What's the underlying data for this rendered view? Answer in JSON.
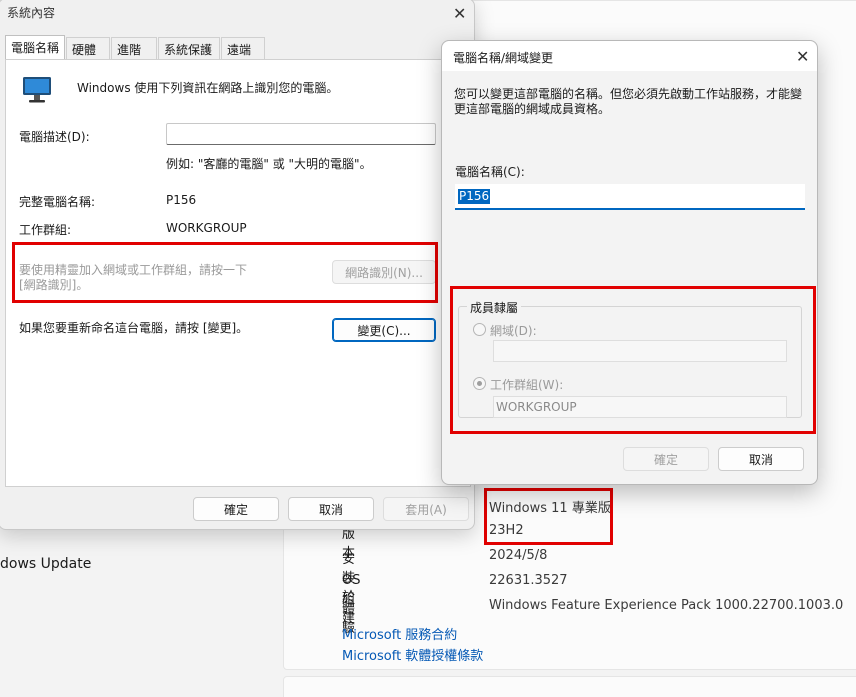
{
  "background": {
    "sidebar_item": "dows Update",
    "windows_edition": "Windows 11 專業版",
    "specs": [
      {
        "label": "版本",
        "value": "23H2"
      },
      {
        "label": "安裝於",
        "value": "2024/5/8"
      },
      {
        "label": "OS 組建",
        "value": "22631.3527"
      },
      {
        "label": "體驗",
        "value": "Windows Feature Experience Pack 1000.22700.1003.0"
      }
    ],
    "links": [
      "Microsoft 服務合約",
      "Microsoft 軟體授權條款"
    ]
  },
  "system_properties": {
    "title": "系統內容",
    "close_icon": "close-icon",
    "tabs": [
      "電腦名稱",
      "硬體",
      "進階",
      "系統保護",
      "遠端"
    ],
    "active_tab": "電腦名稱",
    "intro": "Windows 使用下列資訊在網路上識別您的電腦。",
    "description_label": "電腦描述(D):",
    "description_value": "",
    "example": "例如: \"客廳的電腦\" 或 \"大明的電腦\"。",
    "full_name_label": "完整電腦名稱:",
    "full_name_value": "P156",
    "workgroup_label": "工作群組:",
    "workgroup_value": "WORKGROUP",
    "network_text_line1": "要使用精靈加入網域或工作群組，請按一下",
    "network_text_line2": "[網路識別]。",
    "network_id_button": "網路識別(N)...",
    "rename_text": "如果您要重新命名這台電腦，請按 [變更]。",
    "change_button": "變更(C)...",
    "ok_button": "確定",
    "cancel_button": "取消",
    "apply_button": "套用(A)"
  },
  "name_change_dialog": {
    "title": "電腦名稱/網域變更",
    "close_icon": "close-icon",
    "info_line1": "您可以變更這部電腦的名稱。但您必須先啟動工作站服務，才能變",
    "info_line2": "更這部電腦的網域成員資格。",
    "computer_name_label": "電腦名稱(C):",
    "computer_name_value": "P156",
    "member_of_label": "成員隸屬",
    "domain_label": "網域(D):",
    "domain_value": "",
    "workgroup_label": "工作群組(W):",
    "workgroup_value": "WORKGROUP",
    "workgroup_selected": true,
    "ok_button": "確定",
    "cancel_button": "取消"
  },
  "colors": {
    "highlight_box": "#e10000",
    "accent": "#0067c0",
    "link": "#0559b5"
  }
}
